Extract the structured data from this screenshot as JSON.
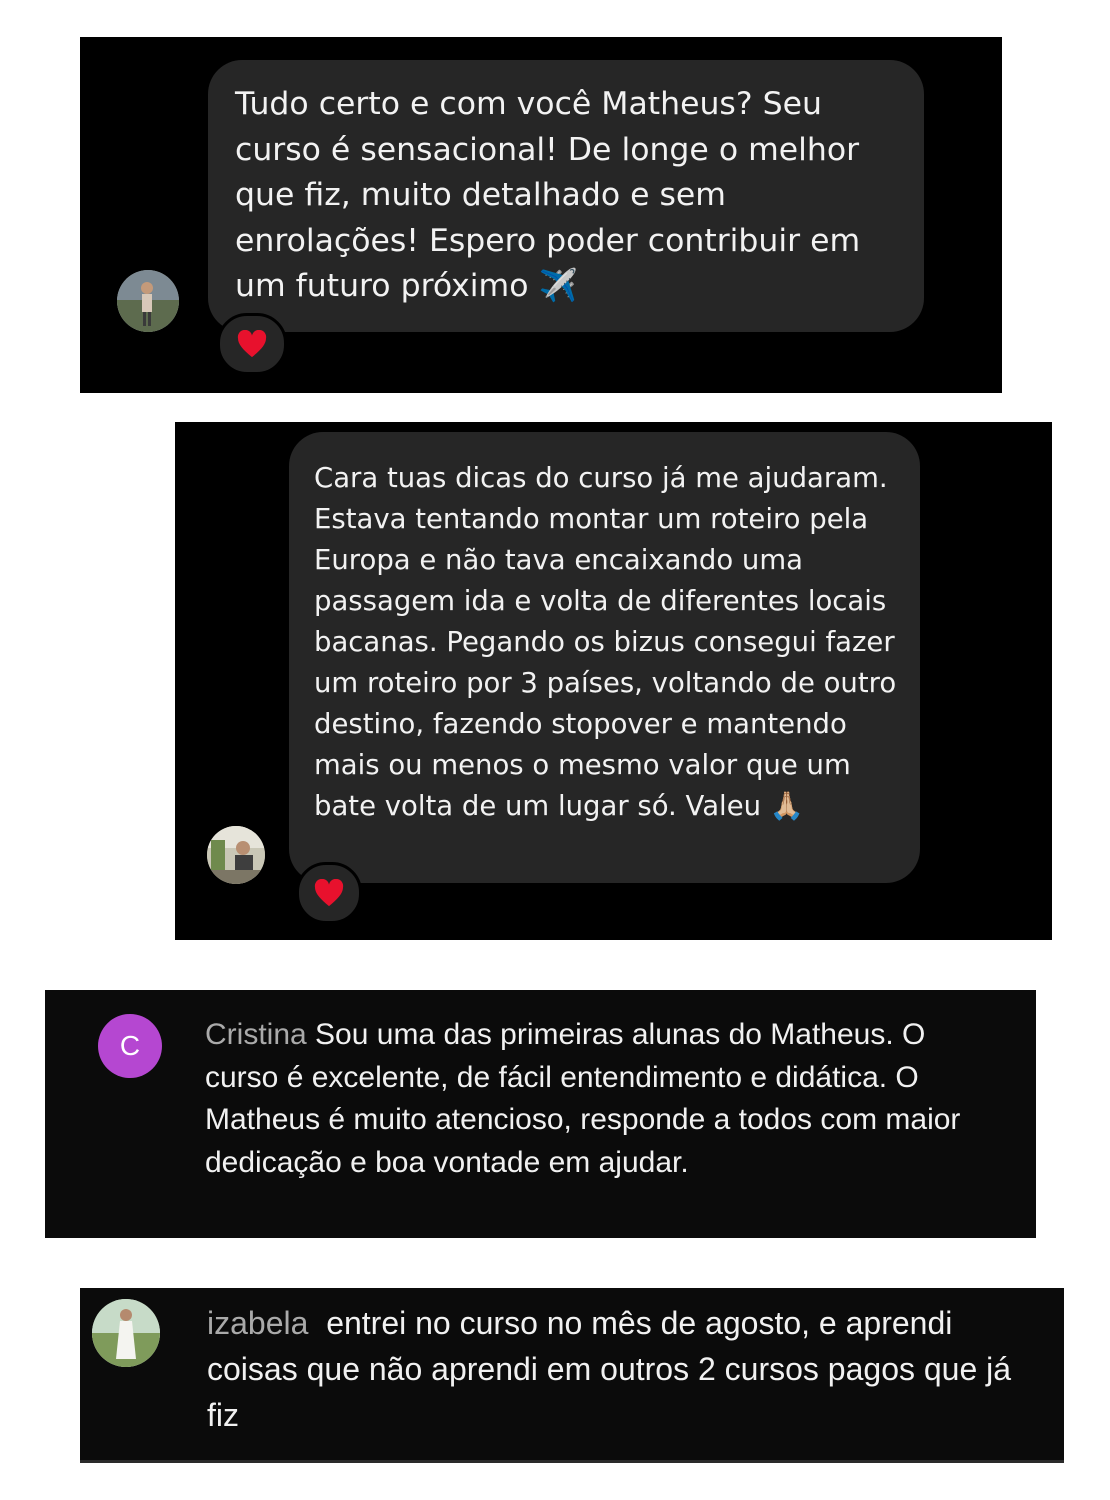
{
  "message1": {
    "text": "Tudo certo e com você Matheus? Seu curso é sensacional! De longe o melhor que fiz, muito detalhado e sem enrolações! Espero poder contribuir em um futuro próximo ✈️",
    "reaction": "❤️"
  },
  "message2": {
    "text": "Cara tuas dicas do curso já me ajudaram. Estava tentando montar um roteiro pela Europa e não tava encaixando uma passagem ida e volta de diferentes locais bacanas. Pegando os bizus consegui fazer um roteiro por 3 países, voltando de outro destino, fazendo stopover e mantendo mais ou menos o mesmo valor que um bate volta de um lugar só. Valeu 🙏🏼",
    "reaction": "❤️"
  },
  "comment1": {
    "initial": "C",
    "author": "Cristina",
    "text": "Sou uma das primeiras alunas do Matheus. O curso é excelente, de fácil entendimento e didática. O Matheus é muito atencioso, responde a todos com maior dedicação e boa vontade em ajudar.",
    "avatar_color": "#b547d1"
  },
  "comment2": {
    "author": "izabela",
    "text": "entrei no curso no mês de agosto, e aprendi coisas que não aprendi em outros 2 cursos pagos que já fiz"
  },
  "icons": [
    "avatar-photo",
    "heart-reaction",
    "airplane-emoji",
    "praying-hands-emoji"
  ]
}
